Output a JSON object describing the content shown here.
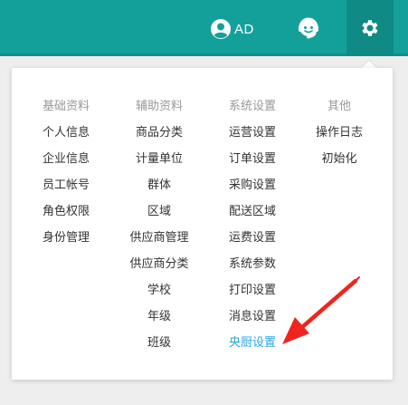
{
  "header": {
    "user": {
      "name": "AD",
      "icon": "user-avatar-icon"
    },
    "support_icon": "headset-support-icon",
    "settings_icon": "gear-icon",
    "colors": {
      "topbar": "#14a09a",
      "settings_tab": "#0f8a84",
      "active_link": "#2aa6e0"
    }
  },
  "menu": {
    "columns": [
      {
        "title": "基础资料",
        "items": [
          "个人信息",
          "企业信息",
          "员工帐号",
          "角色权限",
          "身份管理"
        ]
      },
      {
        "title": "辅助资料",
        "items": [
          "商品分类",
          "计量单位",
          "群体",
          "区域",
          "供应商管理",
          "供应商分类",
          "学校",
          "年级",
          "班级"
        ]
      },
      {
        "title": "系统设置",
        "items": [
          "运营设置",
          "订单设置",
          "采购设置",
          "配送区域",
          "运费设置",
          "系统参数",
          "打印设置",
          "消息设置",
          "央厨设置"
        ]
      },
      {
        "title": "其他",
        "items": [
          "操作日志",
          "初始化"
        ]
      }
    ],
    "active_item": "央厨设置",
    "annotation": {
      "type": "red-arrow",
      "points_to": "央厨设置"
    }
  }
}
